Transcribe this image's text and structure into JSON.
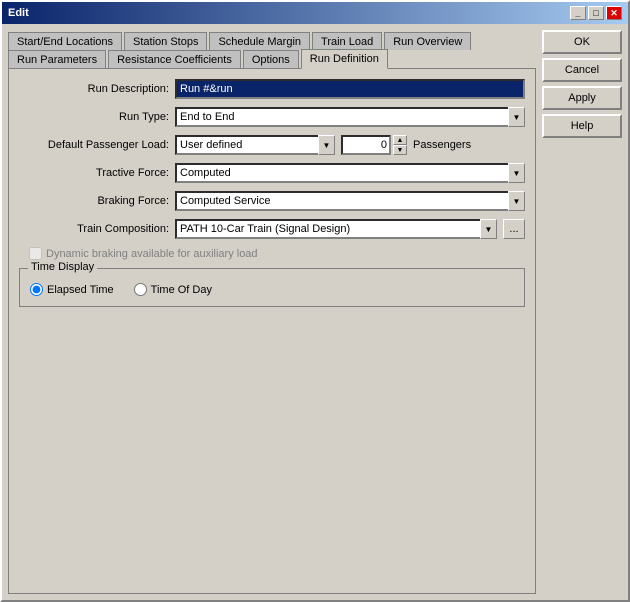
{
  "window": {
    "title": "Edit"
  },
  "tabs": {
    "row1": [
      {
        "id": "start-end",
        "label": "Start/End Locations"
      },
      {
        "id": "station-stops",
        "label": "Station Stops"
      },
      {
        "id": "schedule-margin",
        "label": "Schedule Margin"
      },
      {
        "id": "train-load",
        "label": "Train Load"
      },
      {
        "id": "run-overview",
        "label": "Run Overview"
      }
    ],
    "row2": [
      {
        "id": "run-params",
        "label": "Run Parameters"
      },
      {
        "id": "resistance-coefficients",
        "label": "Resistance Coefficients"
      },
      {
        "id": "options",
        "label": "Options"
      },
      {
        "id": "run-definition",
        "label": "Run Definition",
        "active": true
      }
    ]
  },
  "form": {
    "run_description_label": "Run Description:",
    "run_description_value": "Run #&run",
    "run_type_label": "Run Type:",
    "run_type_value": "End to End",
    "run_type_options": [
      "End to End"
    ],
    "default_passenger_load_label": "Default Passenger Load:",
    "default_passenger_load_value": "User defined",
    "default_passenger_load_options": [
      "User defined"
    ],
    "passengers_count": "0",
    "passengers_label": "Passengers",
    "tractive_force_label": "Tractive Force:",
    "tractive_force_value": "Computed",
    "tractive_force_options": [
      "Computed"
    ],
    "braking_force_label": "Braking Force:",
    "braking_force_value": "Computed Service",
    "braking_force_options": [
      "Computed Service"
    ],
    "train_composition_label": "Train Composition:",
    "train_composition_value": "PATH 10-Car Train (Signal Design)",
    "train_composition_options": [
      "PATH 10-Car Train (Signal Design)"
    ],
    "browse_label": "...",
    "dynamic_braking_label": "Dynamic braking available for auxiliary load",
    "time_display_group_label": "Time Display",
    "elapsed_time_label": "Elapsed Time",
    "time_of_day_label": "Time Of Day"
  },
  "buttons": {
    "ok": "OK",
    "cancel": "Cancel",
    "apply": "Apply",
    "help": "Help"
  },
  "title_buttons": {
    "minimize": "_",
    "maximize": "□",
    "close": "✕"
  }
}
